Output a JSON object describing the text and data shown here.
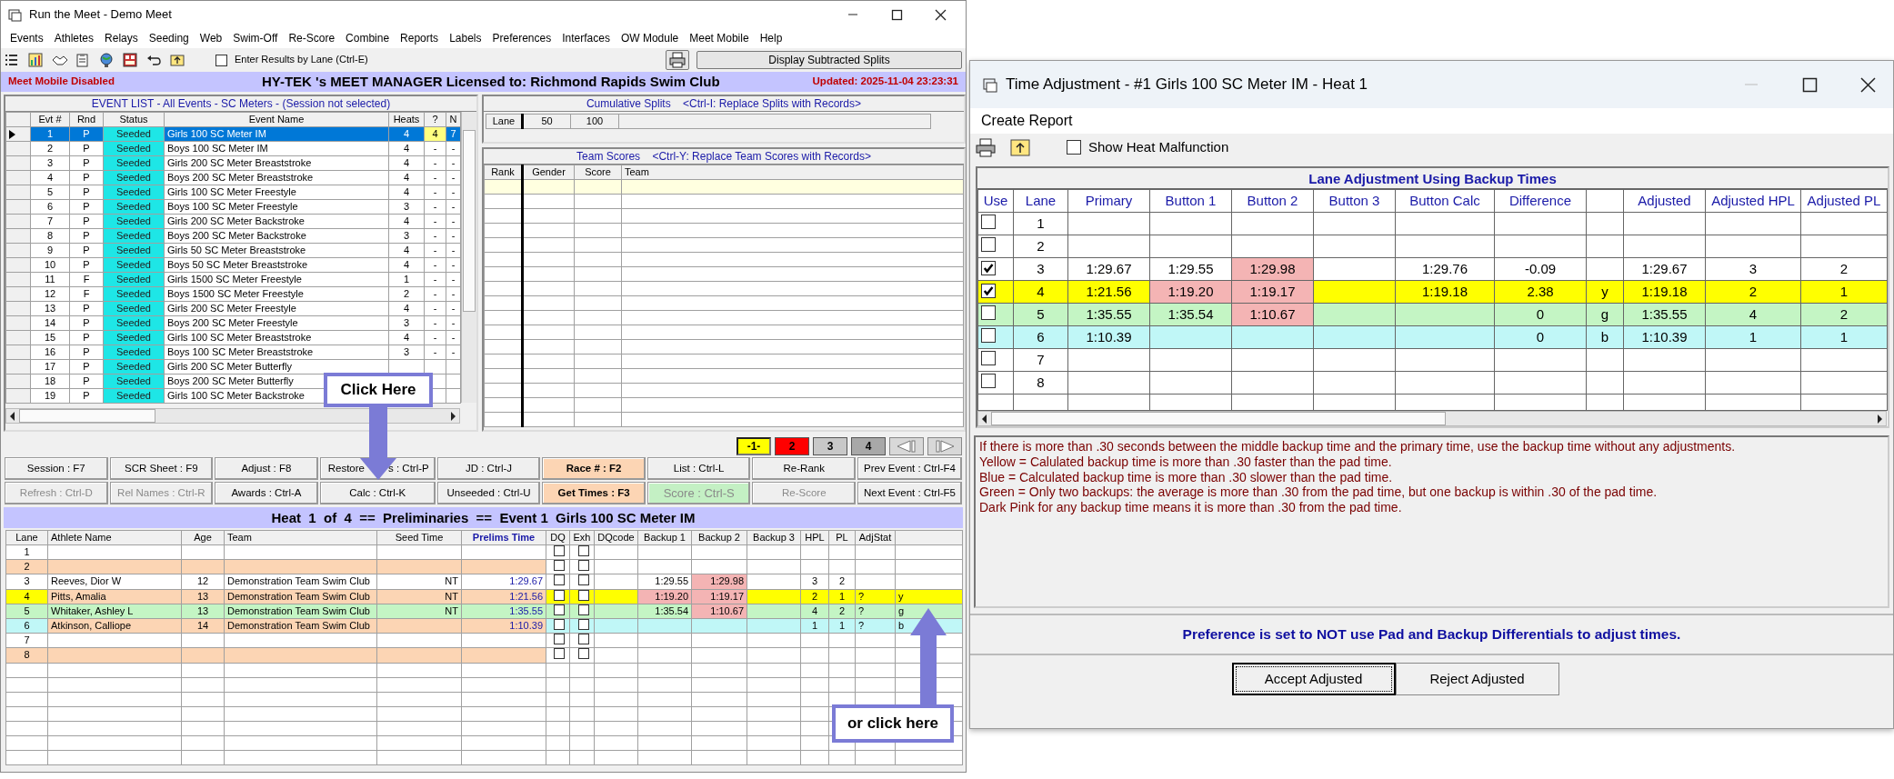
{
  "main_window": {
    "title": "Run the Meet - Demo Meet"
  },
  "menu": [
    "Events",
    "Athletes",
    "Relays",
    "Seeding",
    "Web",
    "Swim-Off",
    "Re-Score",
    "Combine",
    "Reports",
    "Labels",
    "Preferences",
    "Interfaces",
    "OW Module",
    "Meet Mobile",
    "Help"
  ],
  "toolbar": {
    "lane_entry": {
      "label": "Enter Results by Lane (Ctrl-E)",
      "checked": false
    },
    "splits_button": "Display Subtracted Splits"
  },
  "status_band": {
    "left": "Meet Mobile Disabled",
    "center": "HY-TEK 's MEET MANAGER Licensed to:  Richmond Rapids Swim Club",
    "right": "Updated: 2025-11-04 23:23:31"
  },
  "event_list": {
    "title": "EVENT LIST - All Events - SC Meters - (Session not selected)",
    "columns": [
      "Evt #",
      "Rnd",
      "Status",
      "Event Name",
      "Heats",
      "?",
      "N"
    ],
    "rows": [
      {
        "cells": [
          "1",
          "P",
          "Seeded",
          "Girls 100 SC Meter IM",
          "4",
          "4",
          "7"
        ],
        "selected": true
      },
      {
        "cells": [
          "2",
          "P",
          "Seeded",
          "Boys 100 SC Meter IM",
          "4",
          "-",
          "-"
        ],
        "selected": false
      },
      {
        "cells": [
          "3",
          "P",
          "Seeded",
          "Girls 200 SC Meter Breaststroke",
          "4",
          "-",
          "-"
        ],
        "selected": false
      },
      {
        "cells": [
          "4",
          "P",
          "Seeded",
          "Boys 200 SC Meter Breaststroke",
          "4",
          "-",
          "-"
        ],
        "selected": false
      },
      {
        "cells": [
          "5",
          "P",
          "Seeded",
          "Girls 100 SC Meter Freestyle",
          "4",
          "-",
          "-"
        ],
        "selected": false
      },
      {
        "cells": [
          "6",
          "P",
          "Seeded",
          "Boys 100 SC Meter Freestyle",
          "3",
          "-",
          "-"
        ],
        "selected": false
      },
      {
        "cells": [
          "7",
          "P",
          "Seeded",
          "Girls 200 SC Meter Backstroke",
          "4",
          "-",
          "-"
        ],
        "selected": false
      },
      {
        "cells": [
          "8",
          "P",
          "Seeded",
          "Boys 200 SC Meter Backstroke",
          "3",
          "-",
          "-"
        ],
        "selected": false
      },
      {
        "cells": [
          "9",
          "P",
          "Seeded",
          "Girls 50 SC Meter Breaststroke",
          "4",
          "-",
          "-"
        ],
        "selected": false
      },
      {
        "cells": [
          "10",
          "P",
          "Seeded",
          "Boys 50 SC Meter Breaststroke",
          "4",
          "-",
          "-"
        ],
        "selected": false
      },
      {
        "cells": [
          "11",
          "F",
          "Seeded",
          "Girls 1500 SC Meter Freestyle",
          "1",
          "-",
          "-"
        ],
        "selected": false
      },
      {
        "cells": [
          "12",
          "F",
          "Seeded",
          "Boys 1500 SC Meter Freestyle",
          "2",
          "-",
          "-"
        ],
        "selected": false
      },
      {
        "cells": [
          "13",
          "P",
          "Seeded",
          "Girls 200 SC Meter Freestyle",
          "4",
          "-",
          "-"
        ],
        "selected": false
      },
      {
        "cells": [
          "14",
          "P",
          "Seeded",
          "Boys 200 SC Meter Freestyle",
          "3",
          "-",
          "-"
        ],
        "selected": false
      },
      {
        "cells": [
          "15",
          "P",
          "Seeded",
          "Girls 100 SC Meter Breaststroke",
          "4",
          "-",
          "-"
        ],
        "selected": false
      },
      {
        "cells": [
          "16",
          "P",
          "Seeded",
          "Boys 100 SC Meter Breaststroke",
          "3",
          "-",
          "-"
        ],
        "selected": false
      },
      {
        "cells": [
          "17",
          "P",
          "Seeded",
          "Girls 200 SC Meter Butterfly"
        ],
        "selected": false
      },
      {
        "cells": [
          "18",
          "P",
          "Seeded",
          "Boys 200 SC Meter Butterfly"
        ],
        "selected": false
      },
      {
        "cells": [
          "19",
          "P",
          "Seeded",
          "Girls 100 SC Meter Backstroke"
        ],
        "selected": false
      }
    ]
  },
  "splits": {
    "title": "Cumulative Splits    <Ctrl-I: Replace Splits with Records>",
    "columns": [
      "Lane",
      "50",
      "100"
    ]
  },
  "team_scores": {
    "title": "Team Scores    <Ctrl-Y: Replace Team Scores with Records>",
    "columns": [
      "Rank",
      "Gender",
      "Score",
      "Team"
    ]
  },
  "heat_buttons": [
    {
      "label": "-1-",
      "color": "#ffff00",
      "selected": true
    },
    {
      "label": "2",
      "color": "#ff0000",
      "selected": false
    },
    {
      "label": "3",
      "color": "#c8c8c8",
      "selected": false
    },
    {
      "label": "4",
      "color": "#a8a8a8",
      "selected": false
    }
  ],
  "command_buttons": [
    {
      "label": "Session : F7",
      "kind": "plain",
      "disabled": false
    },
    {
      "label": "SCR Sheet : F9",
      "kind": "plain",
      "disabled": false
    },
    {
      "label": "Adjust : F8",
      "kind": "plain",
      "disabled": false
    },
    {
      "label": "Restore",
      "label_tail": "s : Ctrl-P",
      "kind": "plain",
      "disabled": false
    },
    {
      "label": "JD : Ctrl-J",
      "kind": "plain",
      "disabled": false
    },
    {
      "label": "Race # : F2",
      "kind": "accent",
      "disabled": false
    },
    {
      "label": "List : Ctrl-L",
      "kind": "plain",
      "disabled": false
    },
    {
      "label": "Re-Rank",
      "kind": "plain",
      "disabled": false
    },
    {
      "label": "Prev Event : Ctrl-F4",
      "kind": "plain",
      "disabled": false
    },
    {
      "label": "Refresh : Ctrl-D",
      "kind": "plain",
      "disabled": true
    },
    {
      "label": "Rel Names : Ctrl-R",
      "kind": "plain",
      "disabled": true
    },
    {
      "label": "Awards : Ctrl-A",
      "kind": "plain",
      "disabled": false
    },
    {
      "label": "Calc : Ctrl-K",
      "kind": "plain",
      "disabled": false
    },
    {
      "label": "Unseeded : Ctrl-U",
      "kind": "plain",
      "disabled": false
    },
    {
      "label": "Get Times : F3",
      "kind": "accent",
      "disabled": false
    },
    {
      "label": "Score : Ctrl-S",
      "kind": "go",
      "disabled": true
    },
    {
      "label": "Re-Score",
      "kind": "plain",
      "disabled": true
    },
    {
      "label": "Next Event : Ctrl-F5",
      "kind": "plain",
      "disabled": false
    }
  ],
  "heat": {
    "title": "Heat  1  of  4  ==  Preliminaries  ==  Event 1  Girls 100 SC Meter IM",
    "columns": [
      "Lane",
      "Athlete Name",
      "Age",
      "Team",
      "Seed Time",
      "Prelims Time",
      "DQ",
      "Exh",
      "DQcode",
      "Backup 1",
      "Backup 2",
      "Backup 3",
      "HPL",
      "PL",
      "AdjStat"
    ],
    "rows": [
      {
        "lane": "1",
        "shaded": false,
        "dq": false,
        "exh": false
      },
      {
        "lane": "2",
        "shaded": true,
        "dq": false,
        "exh": false
      },
      {
        "lane": "3",
        "shaded": false,
        "name": "Reeves, Dior W",
        "age": "12",
        "team": "Demonstration Team Swim Club",
        "seed": "NT",
        "prelims": "1:29.67",
        "dq": false,
        "exh": false,
        "backup_1": {
          "time": "1:29.55",
          "out_of_range": false
        },
        "backup_2": {
          "time": "1:29.98",
          "out_of_range": true
        },
        "hpl": "3",
        "pl": "2"
      },
      {
        "lane": "4",
        "shaded": true,
        "color": "#ffff00",
        "name": "Pitts, Amalia",
        "age": "13",
        "team": "Demonstration Team Swim Club",
        "seed": "NT",
        "prelims": "1:21.56",
        "dq": false,
        "exh": false,
        "backup_1": {
          "time": "1:19.20",
          "out_of_range": true
        },
        "backup_2": {
          "time": "1:19.17",
          "out_of_range": true
        },
        "hpl": "2",
        "pl": "1",
        "adj_stat": "?",
        "column_16": "y"
      },
      {
        "lane": "5",
        "shaded": false,
        "color": "#c4f5c4",
        "name": "Whitaker, Ashley L",
        "age": "13",
        "team": "Demonstration Team Swim Club",
        "seed": "NT",
        "prelims": "1:35.55",
        "dq": false,
        "exh": false,
        "backup_1": {
          "time": "1:35.54",
          "out_of_range": false
        },
        "backup_2": {
          "time": "1:10.67",
          "out_of_range": true
        },
        "hpl": "4",
        "pl": "2",
        "adj_stat": "?",
        "column_16": "g"
      },
      {
        "lane": "6",
        "shaded": true,
        "color": "#c0f7f7",
        "name": "Atkinson, Calliope",
        "age": "14",
        "team": "Demonstration Team Swim Club",
        "prelims": "1:10.39",
        "dq": false,
        "exh": false,
        "hpl": "1",
        "pl": "1",
        "adj_stat": "?",
        "column_16": "b"
      },
      {
        "lane": "7",
        "shaded": false,
        "dq": false,
        "exh": false
      },
      {
        "lane": "8",
        "shaded": true,
        "dq": false,
        "exh": false
      }
    ]
  },
  "callouts": [
    {
      "text": "Click Here",
      "kind": "down"
    },
    {
      "text": "or click here",
      "kind": "up"
    }
  ],
  "adjust_window": {
    "title": "Time Adjustment - #1 Girls 100 SC Meter IM - Heat 1",
    "menu": [
      "Create Report"
    ],
    "malfunction": {
      "label": "Show Heat Malfunction",
      "checked": false
    },
    "table": {
      "title": "Lane Adjustment Using Backup Times",
      "columns": [
        "Use",
        "Lane",
        "Primary",
        "Button 1",
        "Button 2",
        "Button 3",
        "Button Calc",
        "Difference",
        "Adjusted",
        "Adjusted HPL",
        "Adjusted PL"
      ],
      "rows": [
        {
          "use": false,
          "lane": "1"
        },
        {
          "use": false,
          "lane": "2"
        },
        {
          "use": true,
          "lane": "3",
          "primary": "1:29.67",
          "button_1": {
            "time": "1:29.55",
            "out_of_range": false
          },
          "button_2": {
            "time": "1:29.98",
            "out_of_range": true
          },
          "calc": "1:29.76",
          "difference": "-0.09",
          "adjusted": "1:29.67",
          "adjusted_hpl": "3",
          "adjusted_pl": "2"
        },
        {
          "use": true,
          "lane": "4",
          "color": "#ffff00",
          "primary": "1:21.56",
          "button_1": {
            "time": "1:19.20",
            "out_of_range": true
          },
          "button_2": {
            "time": "1:19.17",
            "out_of_range": true
          },
          "calc": "1:19.18",
          "difference": "2.38",
          "column_9": "y",
          "adjusted": "1:19.18",
          "adjusted_hpl": "2",
          "adjusted_pl": "1"
        },
        {
          "use": false,
          "lane": "5",
          "color": "#c4f5c4",
          "primary": "1:35.55",
          "button_1": {
            "time": "1:35.54",
            "out_of_range": false
          },
          "button_2": {
            "time": "1:10.67",
            "out_of_range": true
          },
          "difference": "0",
          "column_9": "g",
          "adjusted": "1:35.55",
          "adjusted_hpl": "4",
          "adjusted_pl": "2"
        },
        {
          "use": false,
          "lane": "6",
          "color": "#c0f7f7",
          "primary": "1:10.39",
          "difference": "0",
          "column_9": "b",
          "adjusted": "1:10.39",
          "adjusted_hpl": "1",
          "adjusted_pl": "1"
        },
        {
          "use": false,
          "lane": "7"
        },
        {
          "use": false,
          "lane": "8"
        }
      ]
    },
    "notes": [
      "If there is more than .30 seconds between the middle backup time and the primary time, use the backup time without any adjustments.",
      "Yellow = Calulated backup time is more than .30 faster than the pad time.",
      "Blue = Calculated backup time is more than .30 slower than the pad time.",
      "Green = Only two backups: the average is more than .30 from the pad time, but one backup is within .30 of the pad time.",
      "Dark Pink for any backup time means it is more than .30 from the pad time."
    ],
    "preference": "Preference is set to NOT use Pad and Backup Differentials to adjust times.",
    "buttons": [
      {
        "label": "Accept Adjusted",
        "focused": true
      },
      {
        "label": "Reject Adjusted",
        "focused": false
      }
    ]
  }
}
